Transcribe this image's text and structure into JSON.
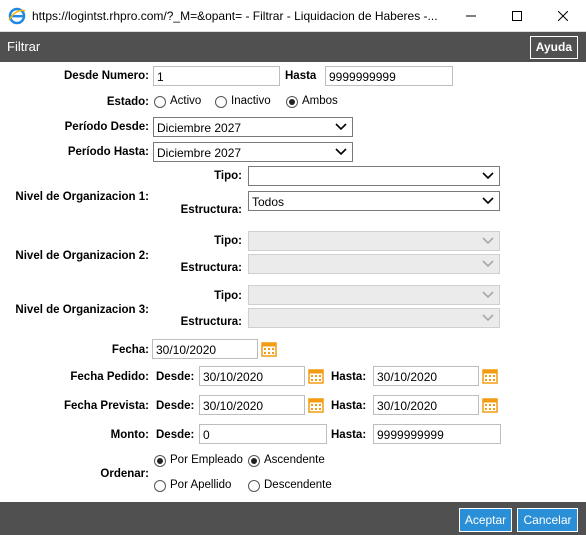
{
  "window": {
    "title": "https://logintst.rhpro.com/?_M=&opant= - Filtrar - Liquidacion de Haberes -..."
  },
  "header": {
    "title": "Filtrar",
    "help_label": "Ayuda"
  },
  "form": {
    "desde_numero": {
      "label": "Desde Numero:",
      "value": "1"
    },
    "hasta_numero": {
      "label": "Hasta",
      "value": "9999999999"
    },
    "estado": {
      "label": "Estado:",
      "options": [
        "Activo",
        "Inactivo",
        "Ambos"
      ],
      "selected": "Ambos"
    },
    "periodo_desde": {
      "label": "Período Desde:",
      "value": "Diciembre 2027"
    },
    "periodo_hasta": {
      "label": "Período Hasta:",
      "value": "Diciembre 2027"
    },
    "nivel1": {
      "label": "Nivel de Organizacion 1:",
      "tipo_label": "Tipo:",
      "tipo_value": "",
      "estructura_label": "Estructura:",
      "estructura_value": "Todos"
    },
    "nivel2": {
      "label": "Nivel de Organizacion 2:",
      "tipo_label": "Tipo:",
      "estructura_label": "Estructura:"
    },
    "nivel3": {
      "label": "Nivel de Organizacion 3:",
      "tipo_label": "Tipo:",
      "estructura_label": "Estructura:"
    },
    "fecha": {
      "label": "Fecha:",
      "value": "30/10/2020"
    },
    "fecha_pedido": {
      "label": "Fecha Pedido:",
      "desde_label": "Desde:",
      "desde_value": "30/10/2020",
      "hasta_label": "Hasta:",
      "hasta_value": "30/10/2020"
    },
    "fecha_prevista": {
      "label": "Fecha Prevista:",
      "desde_label": "Desde:",
      "desde_value": "30/10/2020",
      "hasta_label": "Hasta:",
      "hasta_value": "30/10/2020"
    },
    "monto": {
      "label": "Monto:",
      "desde_label": "Desde:",
      "desde_value": "0",
      "hasta_label": "Hasta:",
      "hasta_value": "9999999999"
    },
    "ordenar": {
      "label": "Ordenar:",
      "by_options": [
        "Por Empleado",
        "Por Apellido"
      ],
      "by_selected": "Por Empleado",
      "dir_options": [
        "Ascendente",
        "Descendente"
      ],
      "dir_selected": "Ascendente"
    }
  },
  "footer": {
    "accept_label": "Aceptar",
    "cancel_label": "Cancelar"
  },
  "colors": {
    "header_bg": "#505050",
    "button_blue": "#2a8fd6",
    "calendar_orange": "#f39c12",
    "ie_blue": "#1e88e5"
  }
}
